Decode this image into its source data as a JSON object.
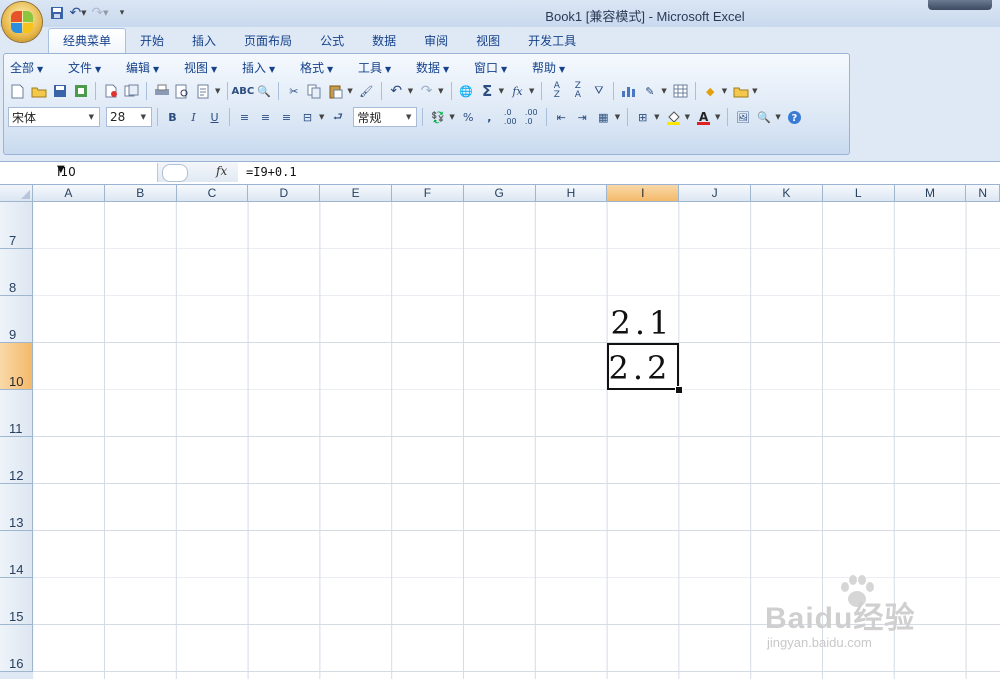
{
  "window": {
    "title": "Book1  [兼容模式] - Microsoft Excel"
  },
  "tabs": [
    "经典菜单",
    "开始",
    "插入",
    "页面布局",
    "公式",
    "数据",
    "审阅",
    "视图",
    "开发工具"
  ],
  "menus": [
    "全部",
    "文件",
    "编辑",
    "视图",
    "插入",
    "格式",
    "工具",
    "数据",
    "窗口",
    "帮助"
  ],
  "toolbar": {
    "font_name": "宋体",
    "font_size": "28",
    "number_format": "常规",
    "bold": "B",
    "italic": "I",
    "underline": "U",
    "sum": "Σ",
    "fx": "fx",
    "percent": "%",
    "comma": ","
  },
  "formula_bar": {
    "name_box": "I10",
    "fx_label": "fx",
    "formula": "=I9+0.1"
  },
  "columns": [
    "A",
    "B",
    "C",
    "D",
    "E",
    "F",
    "G",
    "H",
    "I",
    "J",
    "K",
    "L",
    "M",
    "N"
  ],
  "selected_column": "I",
  "rows": [
    "7",
    "8",
    "9",
    "10",
    "11",
    "12",
    "13",
    "14",
    "15",
    "16"
  ],
  "selected_row": "10",
  "cells": {
    "I9": "2.1",
    "I10": "2.2"
  },
  "watermark": {
    "brand": "Baidu经验",
    "url": "jingyan.baidu.com"
  }
}
